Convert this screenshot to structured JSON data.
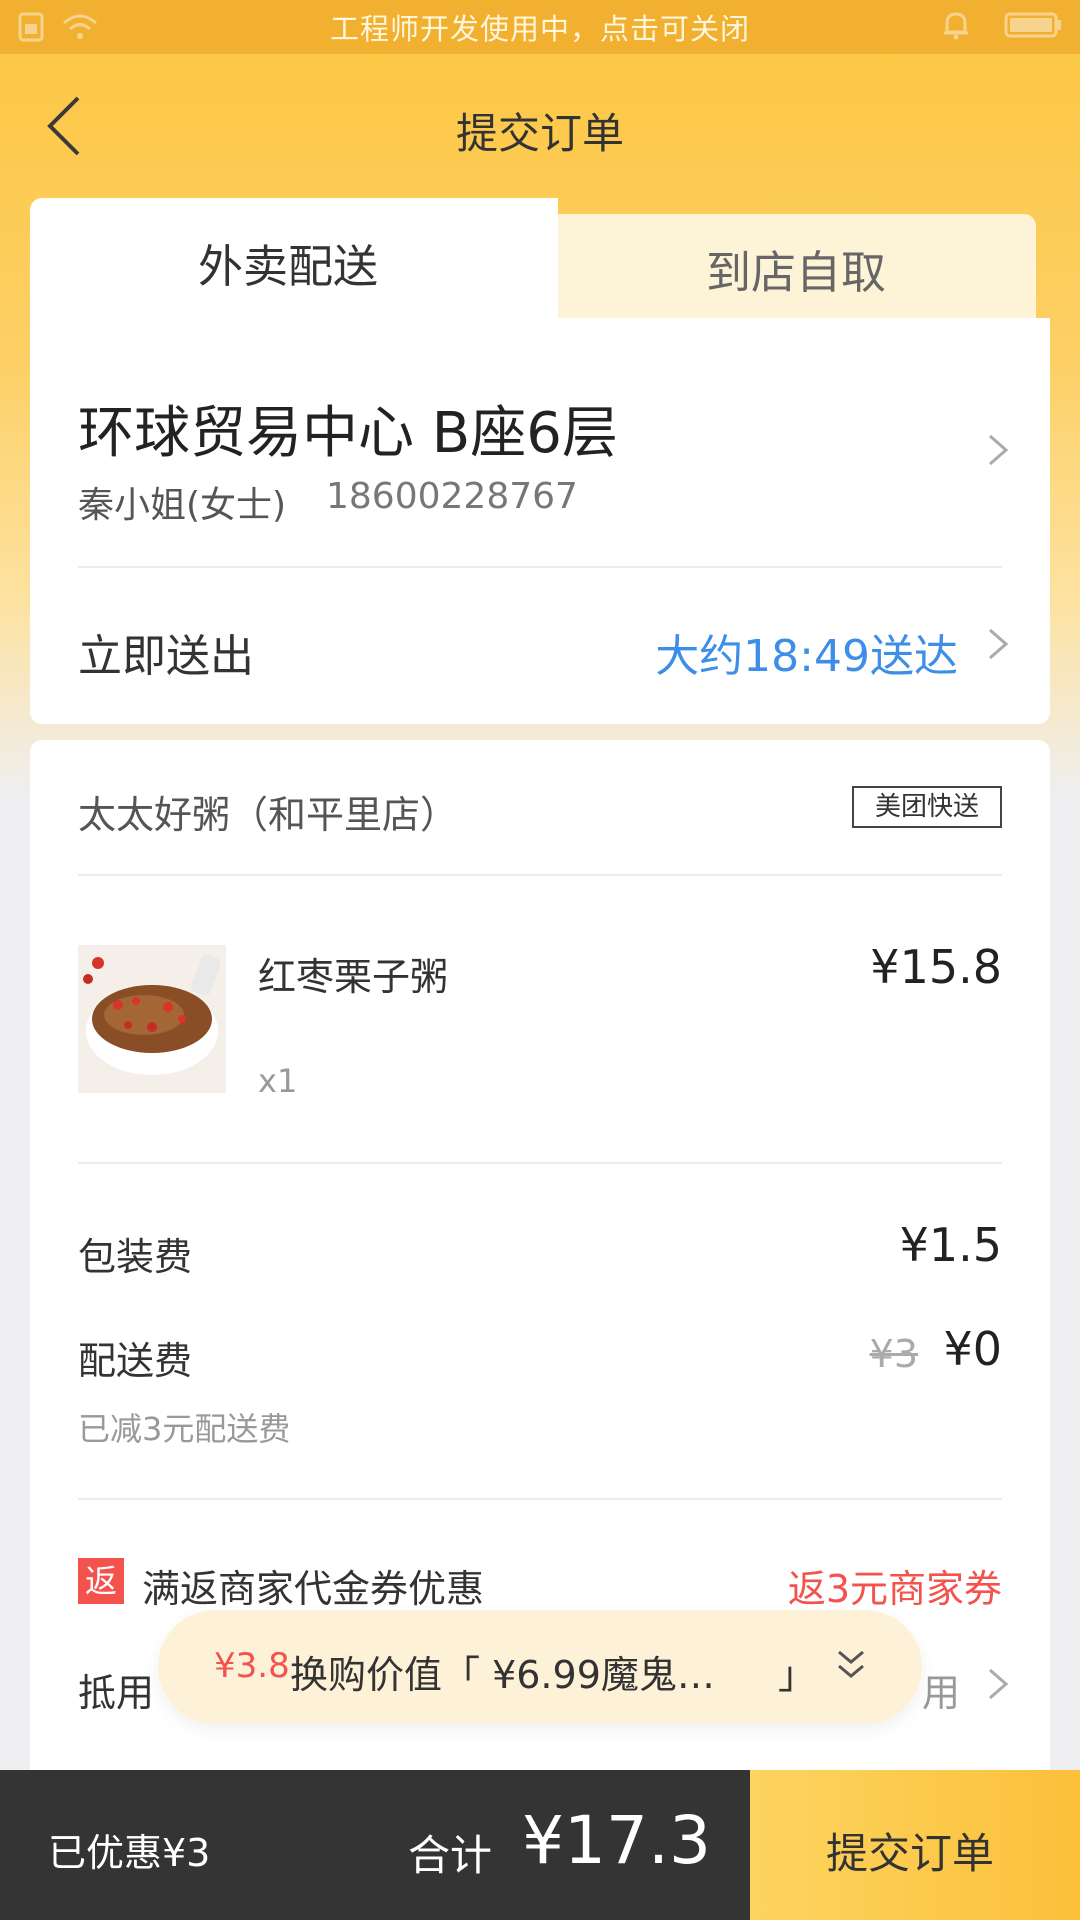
{
  "status_bar": {
    "text": "工程师开发使用中，点击可关闭"
  },
  "nav": {
    "title": "提交订单"
  },
  "tabs": [
    {
      "label": "外卖配送",
      "active": true
    },
    {
      "label": "到店自取",
      "active": false
    }
  ],
  "address": {
    "line": "环球贸易中心 B座6层",
    "contact_name": "秦小姐(女士)",
    "phone": "18600228767"
  },
  "delivery": {
    "label": "立即送出",
    "eta": "大约18:49送达"
  },
  "shop": {
    "name": "太太好粥（和平里店）",
    "badge": "美团快送"
  },
  "items": [
    {
      "name": "红枣栗子粥",
      "price": "¥15.8",
      "qty": "x1"
    }
  ],
  "fees": {
    "packing_label": "包装费",
    "packing_value": "¥1.5",
    "delivery_label": "配送费",
    "delivery_original": "¥3",
    "delivery_value": "¥0",
    "delivery_note": "已减3元配送费"
  },
  "promo": {
    "badge": "返",
    "label": "满返商家代金券优惠",
    "value": "返3元商家券"
  },
  "partial_row": {
    "label": "抵用",
    "value": "用"
  },
  "exchange_pill": {
    "price": "¥3.8",
    "text": "换购价值「 ¥6.99魔鬼…",
    "close_bracket": "」"
  },
  "bottom": {
    "discount": "已优惠¥3",
    "total_label": "合计",
    "total_value": "¥17.3",
    "submit": "提交订单"
  },
  "colors": {
    "brand_yellow": "#fdc640",
    "link_blue": "#3d8ee8",
    "promo_red": "#f3524d",
    "bar_dark": "#343434"
  }
}
